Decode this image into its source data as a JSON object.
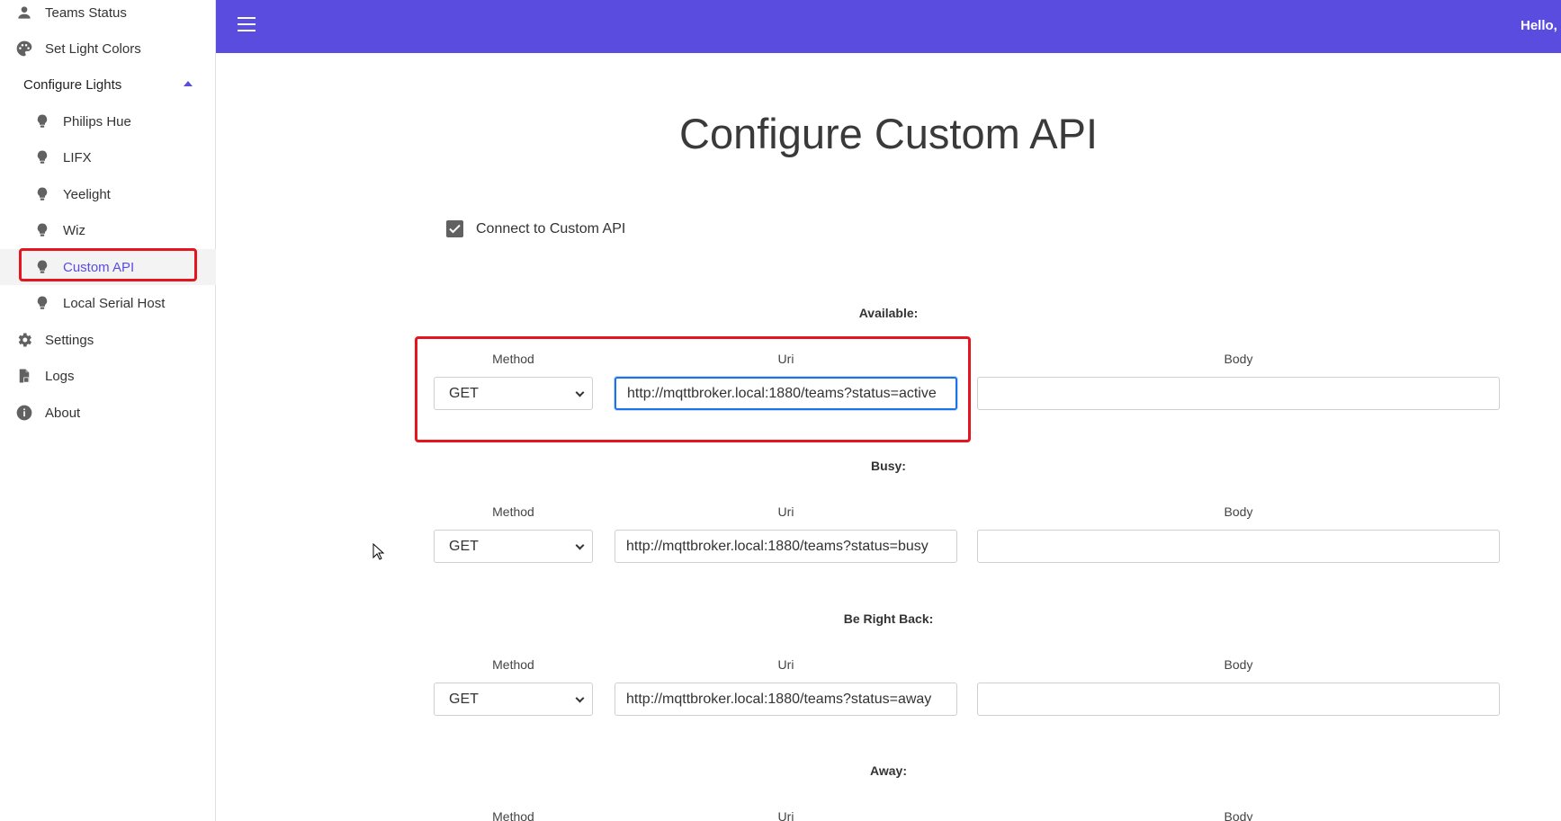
{
  "sidebar": {
    "items": [
      {
        "label": "Teams Status",
        "icon": "person-icon"
      },
      {
        "label": "Set Light Colors",
        "icon": "palette-icon"
      },
      {
        "label": "Configure Lights",
        "icon": "caret-up-icon"
      },
      {
        "label": "Philips Hue",
        "icon": "bulb-icon"
      },
      {
        "label": "LIFX",
        "icon": "bulb-icon"
      },
      {
        "label": "Yeelight",
        "icon": "bulb-icon"
      },
      {
        "label": "Wiz",
        "icon": "bulb-icon"
      },
      {
        "label": "Custom API",
        "icon": "bulb-icon"
      },
      {
        "label": "Local Serial Host",
        "icon": "bulb-icon"
      },
      {
        "label": "Settings",
        "icon": "gear-icon"
      },
      {
        "label": "Logs",
        "icon": "file-icon"
      },
      {
        "label": "About",
        "icon": "info-icon"
      }
    ]
  },
  "header": {
    "greeting": "Hello, I"
  },
  "main": {
    "title": "Configure Custom API",
    "connect_label": "Connect to Custom API",
    "connect_checked": true,
    "column_labels": {
      "method": "Method",
      "uri": "Uri",
      "body": "Body"
    },
    "sections": [
      {
        "label": "Available:",
        "method": "GET",
        "uri": "http://mqttbroker.local:1880/teams?status=active",
        "body": ""
      },
      {
        "label": "Busy:",
        "method": "GET",
        "uri": "http://mqttbroker.local:1880/teams?status=busy",
        "body": ""
      },
      {
        "label": "Be Right Back:",
        "method": "GET",
        "uri": "http://mqttbroker.local:1880/teams?status=away",
        "body": ""
      },
      {
        "label": "Away:",
        "method": "",
        "uri": "",
        "body": ""
      }
    ]
  },
  "colors": {
    "accent": "#5b4ce0",
    "highlight": "#e4151f",
    "focus": "#1a73e8"
  }
}
